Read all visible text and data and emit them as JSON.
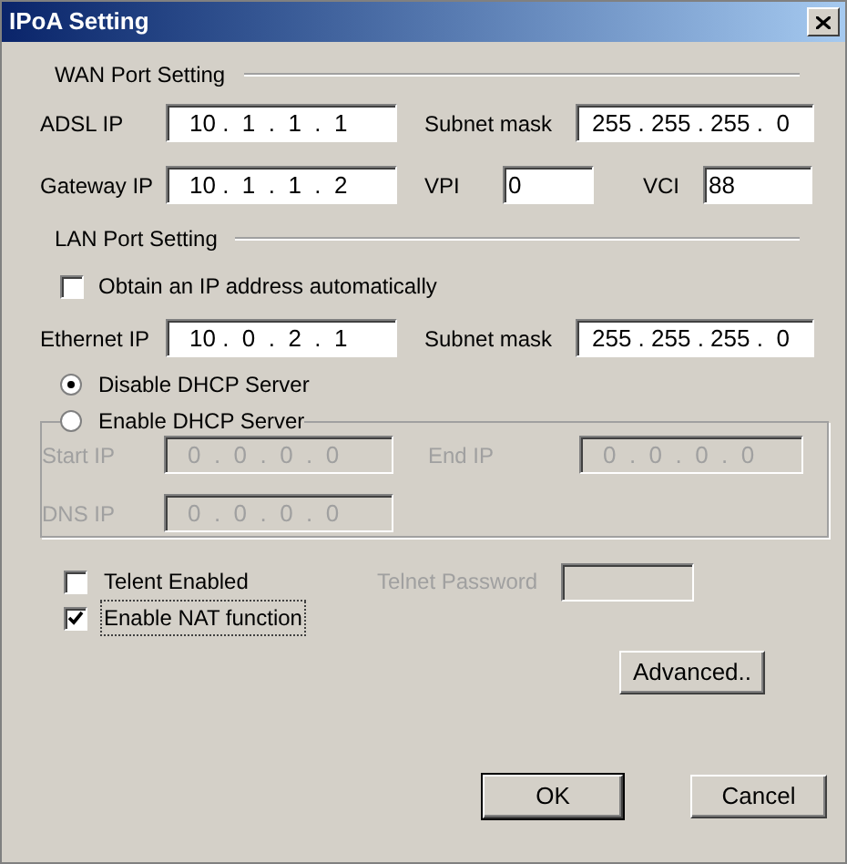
{
  "window": {
    "title": "IPoA Setting"
  },
  "wan": {
    "heading": "WAN Port Setting",
    "adsl_ip": {
      "label": "ADSL IP",
      "value": "10 .  1  .  1  .  1"
    },
    "subnet_mask": {
      "label": "Subnet mask",
      "value": "255 . 255 . 255 .  0"
    },
    "gateway_ip": {
      "label": "Gateway IP",
      "value": "10 .  1  .  1  .  2"
    },
    "vpi": {
      "label": "VPI",
      "value": "0"
    },
    "vci": {
      "label": "VCI",
      "value": "88"
    }
  },
  "lan": {
    "heading": "LAN Port Setting",
    "obtain_auto": {
      "label": "Obtain an IP address automatically",
      "checked": false
    },
    "ethernet_ip": {
      "label": "Ethernet IP",
      "value": "10 .  0  .  2  .  1"
    },
    "subnet_mask": {
      "label": "Subnet mask",
      "value": "255 . 255 . 255 .  0"
    },
    "dhcp_options": [
      {
        "label": "Disable DHCP Server",
        "selected": true
      },
      {
        "label": "Enable DHCP Server",
        "selected": false
      }
    ],
    "start_ip": {
      "label": "Start IP",
      "value": "0  .  0  .  0  .  0",
      "disabled": true
    },
    "end_ip": {
      "label": "End IP",
      "value": "0  .  0  .  0  .  0",
      "disabled": true
    },
    "dns_ip": {
      "label": "DNS IP",
      "value": "0  .  0  .  0  .  0",
      "disabled": true
    }
  },
  "options": {
    "telnet": {
      "label": "Telent Enabled",
      "checked": false
    },
    "telnet_password": {
      "label": "Telnet Password",
      "disabled": true
    },
    "nat": {
      "label": "Enable NAT function",
      "checked": true,
      "focused": true
    }
  },
  "buttons": {
    "advanced": "Advanced..",
    "ok": "OK",
    "cancel": "Cancel"
  }
}
